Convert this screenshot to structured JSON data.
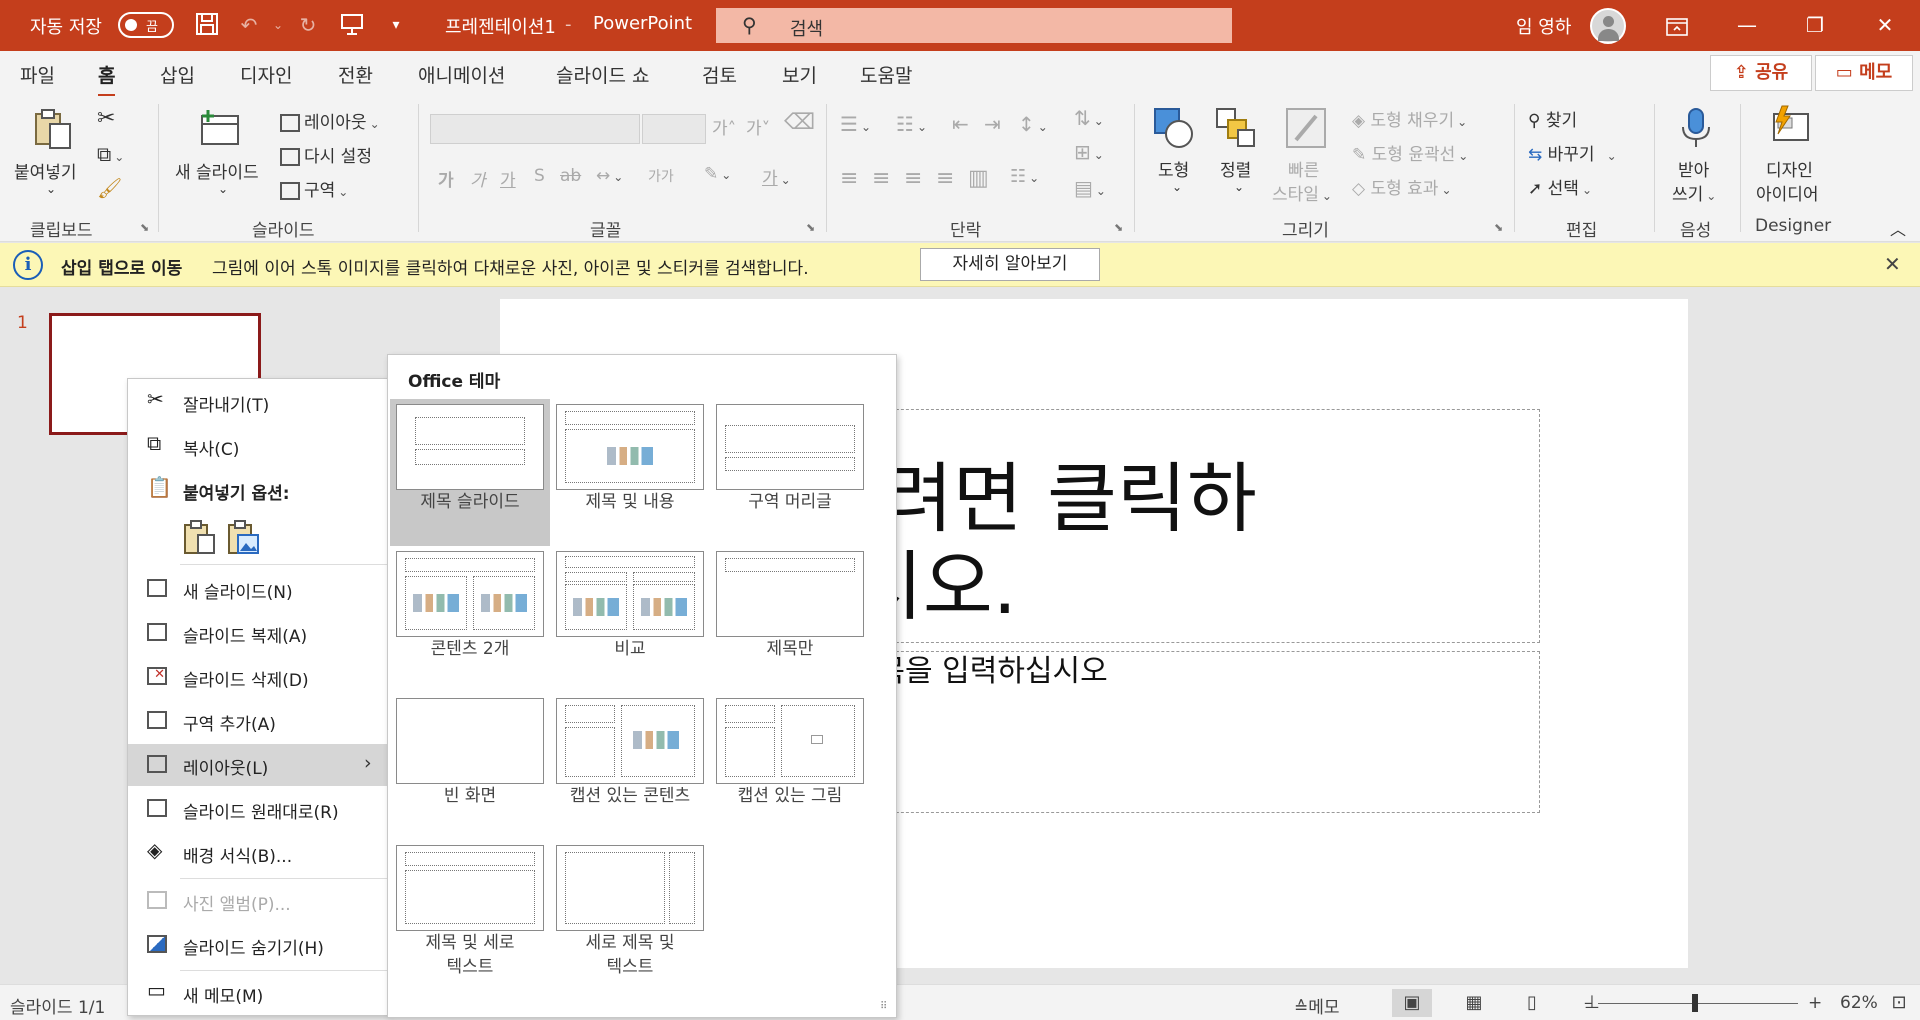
{
  "titlebar": {
    "autosave_label": "자동 저장",
    "autosave_state": "끔",
    "doc_title": "프레젠테이션1",
    "app_name": "PowerPoint",
    "search_placeholder": "검색",
    "user_name": "임 영하"
  },
  "tabs": [
    "파일",
    "홈",
    "삽입",
    "디자인",
    "전환",
    "애니메이션",
    "슬라이드 쇼",
    "검토",
    "보기",
    "도움말"
  ],
  "active_tab": "홈",
  "share_label": "공유",
  "memo_label": "메모",
  "ribbon": {
    "clipboard": {
      "paste": "붙여넣기",
      "group": "클립보드"
    },
    "slides": {
      "new_slide_1": "새",
      "new_slide_2": "슬라이드",
      "layout": "레이아웃",
      "reset": "다시 설정",
      "section": "구역",
      "group": "슬라이드"
    },
    "font": {
      "group": "글꼴",
      "grow": "가˄",
      "shrink": "가˅",
      "bold": "가",
      "italic": "가",
      "underline": "가",
      "strike": "S",
      "spacing": "ab",
      "case": "가가",
      "highlight": "✎",
      "color": "가"
    },
    "paragraph": {
      "group": "단락"
    },
    "drawing": {
      "shapes": "도형",
      "arrange": "정렬",
      "quick_1": "빠른",
      "quick_2": "스타일",
      "fill": "도형 채우기",
      "outline": "도형 윤곽선",
      "effects": "도형 효과",
      "group": "그리기"
    },
    "editing": {
      "find": "찾기",
      "replace": "바꾸기",
      "select": "선택",
      "group": "편집"
    },
    "voice": {
      "dictate_1": "받아",
      "dictate_2": "쓰기",
      "group": "음성"
    },
    "designer": {
      "label_1": "디자인",
      "label_2": "아이디어",
      "group": "Designer"
    }
  },
  "notice": {
    "title": "삽입 탭으로 이동",
    "text": "그림에 이어 스톡 이미지를 클릭하여 다채로운 사진, 아이콘 및 스티커를 검색합니다.",
    "button": "자세히 알아보기"
  },
  "slide_panel": {
    "slide_number": "1"
  },
  "slide": {
    "title_line_1": "추가하려면 클릭하",
    "title_line_2": "십시오.",
    "subtitle": "부제목을 입력하십시오"
  },
  "context_menu": {
    "cut": "잘라내기(T)",
    "copy": "복사(C)",
    "paste_options": "붙여넣기 옵션:",
    "new_slide": "새 슬라이드(N)",
    "duplicate": "슬라이드 복제(A)",
    "delete": "슬라이드 삭제(D)",
    "add_section": "구역 추가(A)",
    "layout": "레이아웃(L)",
    "reset": "슬라이드 원래대로(R)",
    "format_bg": "배경 서식(B)...",
    "photo_album": "사진 앨범(P)...",
    "hide": "슬라이드 숨기기(H)",
    "new_comment": "새 메모(M)"
  },
  "gallery": {
    "header": "Office 테마",
    "layouts": [
      {
        "caption": "제목 슬라이드"
      },
      {
        "caption": "제목 및 내용"
      },
      {
        "caption": "구역 머리글"
      },
      {
        "caption": "콘텐츠 2개"
      },
      {
        "caption": "비교"
      },
      {
        "caption": "제목만"
      },
      {
        "caption": "빈 화면"
      },
      {
        "caption": "캡션 있는 콘텐츠"
      },
      {
        "caption": "캡션 있는 그림"
      },
      {
        "caption_1": "제목 및 세로",
        "caption_2": "텍스트"
      },
      {
        "caption_1": "세로 제목 및",
        "caption_2": "텍스트"
      }
    ]
  },
  "statusbar": {
    "slide_info": "슬라이드 1/1",
    "notes": "메모",
    "zoom": "62%"
  },
  "colors": {
    "accent": "#c43e1c",
    "notice_bg": "#fcf7b6"
  }
}
